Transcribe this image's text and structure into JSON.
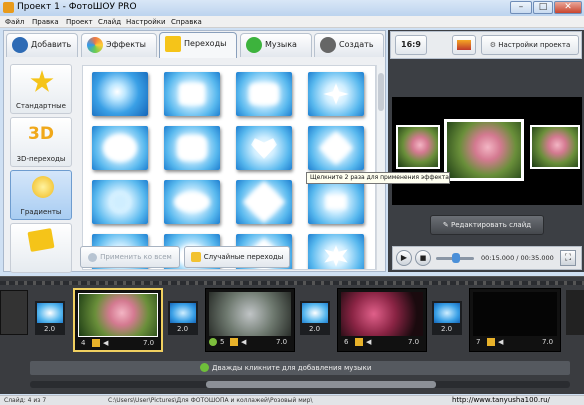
{
  "window": {
    "title": "Проект 1 - ФотоШОУ PRO"
  },
  "menu": [
    "Файл",
    "Правка",
    "Проект",
    "Слайд",
    "Настройки",
    "Справка"
  ],
  "tabs": [
    {
      "label": "Добавить"
    },
    {
      "label": "Эффекты"
    },
    {
      "label": "Переходы"
    },
    {
      "label": "Музыка"
    },
    {
      "label": "Создать"
    }
  ],
  "categories": [
    {
      "label": "Стандартные"
    },
    {
      "label": "3D-переходы",
      "badge": "3D"
    },
    {
      "label": "Градиенты"
    },
    {
      "label": ""
    }
  ],
  "transition_grid": {
    "rows": 4,
    "cols": 4
  },
  "buttons": {
    "apply_all": "Применить ко всем",
    "random": "Случайные переходы",
    "aspect": "16:9",
    "project_settings": "Настройки проекта",
    "edit_slide": "Редактировать слайд"
  },
  "tooltip": "Щелкните 2 раза для применения эффекта",
  "player": {
    "time": "00:15.000 / 00:35.000"
  },
  "timeline": {
    "transitions": [
      {
        "duration": "2.0"
      },
      {
        "duration": "2.0"
      },
      {
        "duration": "2.0"
      },
      {
        "duration": "2.0"
      }
    ],
    "slides": [
      {
        "number": "4",
        "duration": "7.0"
      },
      {
        "number": "5",
        "duration": "7.0"
      },
      {
        "number": "6",
        "duration": "7.0"
      },
      {
        "number": "7",
        "duration": "7.0"
      }
    ],
    "music_hint": "Дважды кликните для добавления музыки"
  },
  "status": {
    "slide_count": "Слайд: 4 из 7",
    "path": "C:\\Users\\User\\Pictures\\Для ФОТОШОПА и коллажей\\Розовый мир\\",
    "watermark": "http://www.tanyusha100.ru/"
  },
  "colors": {
    "accent": "#5ea6e6",
    "timeline_bg": "#3a3c40",
    "selected_border": "#f0d060"
  }
}
